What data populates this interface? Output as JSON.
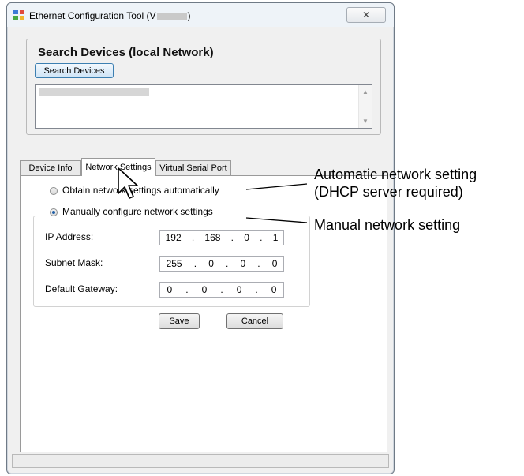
{
  "window": {
    "title_prefix": "Ethernet Configuration Tool (V",
    "title_suffix": ")",
    "close_glyph": "✕"
  },
  "search": {
    "heading": "Search Devices (local Network)",
    "button_label": "Search Devices"
  },
  "tabs": [
    {
      "label": "Device Info",
      "active": false
    },
    {
      "label": "Network Settings",
      "active": true
    },
    {
      "label": "Virtual Serial Port",
      "active": false
    }
  ],
  "network": {
    "auto_label": "Obtain network settings automatically",
    "manual_label": "Manually configure network settings",
    "selected": "manual",
    "fields": [
      {
        "label": "IP Address:",
        "octets": [
          "192",
          "168",
          "0",
          "1"
        ]
      },
      {
        "label": "Subnet Mask:",
        "octets": [
          "255",
          "0",
          "0",
          "0"
        ]
      },
      {
        "label": "Default Gateway:",
        "octets": [
          "0",
          "0",
          "0",
          "0"
        ]
      }
    ],
    "save_label": "Save",
    "cancel_label": "Cancel"
  },
  "callouts": {
    "auto_line1": "Automatic network setting",
    "auto_line2": "(DHCP server required)",
    "manual": "Manual network setting"
  },
  "icons": {
    "app": "network-app-icon",
    "cursor": "mouse-pointer-icon"
  }
}
